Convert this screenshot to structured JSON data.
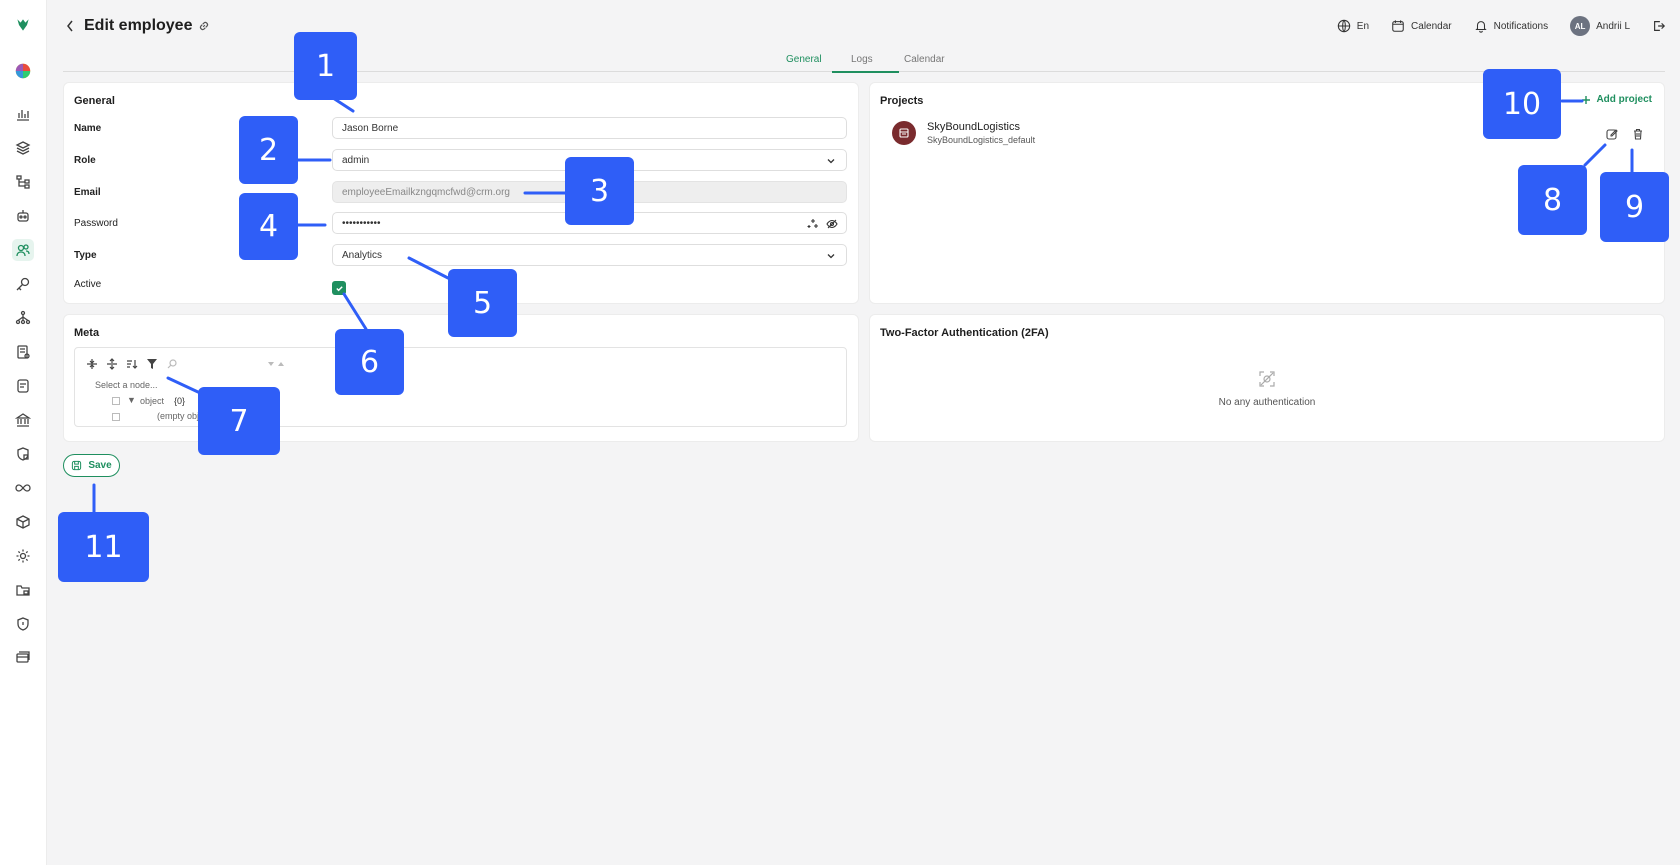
{
  "header": {
    "title": "Edit employee",
    "language": "En",
    "calendar": "Calendar",
    "notifications": "Notifications",
    "avatar_initials": "AL",
    "user_name": "Andrii L"
  },
  "tabs": [
    "General",
    "Logs",
    "Calendar"
  ],
  "general": {
    "title": "General",
    "name_label": "Name",
    "name_value": "Jason Borne",
    "role_label": "Role",
    "role_value": "admin",
    "email_label": "Email",
    "email_value": "employeeEmailkzngqmcfwd@crm.org",
    "password_label": "Password",
    "password_value": "•••••••••••",
    "type_label": "Type",
    "type_value": "Analytics",
    "active_label": "Active",
    "active_checked": true
  },
  "meta": {
    "title": "Meta",
    "select_node": "Select a node...",
    "object_label": "object",
    "object_count": "{0}",
    "empty_object": "(empty object)"
  },
  "projects": {
    "title": "Projects",
    "add_label": "Add project",
    "items": [
      {
        "name": "SkyBoundLogistics",
        "sub": "SkyBoundLogistics_default"
      }
    ]
  },
  "twofa": {
    "title": "Two-Factor Authentication (2FA)",
    "empty_text": "No any authentication"
  },
  "save_label": "Save",
  "callouts": [
    "1",
    "2",
    "3",
    "4",
    "5",
    "6",
    "7",
    "8",
    "9",
    "10",
    "11"
  ],
  "colors": {
    "accent": "#1f8f5f",
    "callout": "#2f5ef7"
  }
}
